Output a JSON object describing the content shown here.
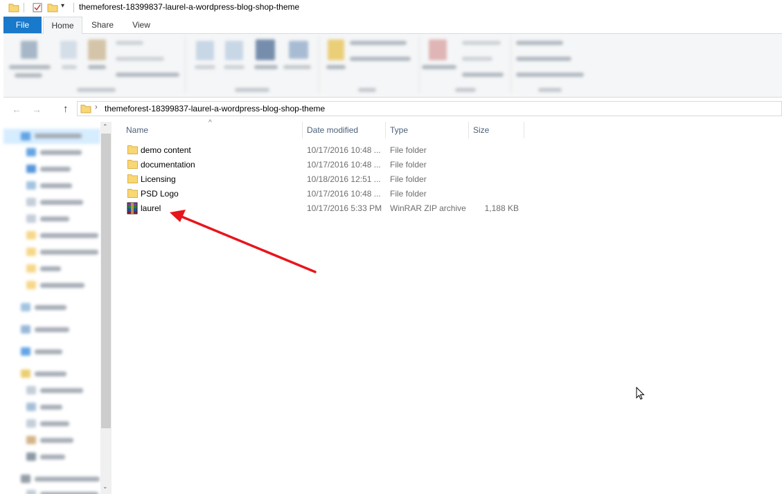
{
  "window": {
    "title": "themeforest-18399837-laurel-a-wordpress-blog-shop-theme",
    "qat_menu_glyph": "▾"
  },
  "ribbon": {
    "tabs": {
      "file": "File",
      "home": "Home",
      "share": "Share",
      "view": "View"
    },
    "active_tab": "Home",
    "accent_color": "#1979ca"
  },
  "address": {
    "path": "themeforest-18399837-laurel-a-wordpress-blog-shop-theme",
    "back_glyph": "←",
    "forward_glyph": "→",
    "up_glyph": "↑",
    "chevron_glyph": "›"
  },
  "columns": {
    "name": "Name",
    "date": "Date modified",
    "type": "Type",
    "size": "Size",
    "sort_glyph": "^"
  },
  "files": [
    {
      "name": "demo content",
      "date": "10/17/2016 10:48 ...",
      "type": "File folder",
      "size": "",
      "icon": "folder-icon"
    },
    {
      "name": "documentation",
      "date": "10/17/2016 10:48 ...",
      "type": "File folder",
      "size": "",
      "icon": "folder-icon"
    },
    {
      "name": "Licensing",
      "date": "10/18/2016 12:51 ...",
      "type": "File folder",
      "size": "",
      "icon": "folder-icon"
    },
    {
      "name": "PSD Logo",
      "date": "10/17/2016 10:48 ...",
      "type": "File folder",
      "size": "",
      "icon": "folder-icon"
    },
    {
      "name": "laurel",
      "date": "10/17/2016 5:33 PM",
      "type": "WinRAR ZIP archive",
      "size": "1,188 KB",
      "icon": "winrar-archive-icon"
    }
  ],
  "scrollbar": {
    "up_glyph": "⌃",
    "down_glyph": "⌄"
  },
  "annotation": {
    "color": "#e8151b",
    "target": "laurel"
  }
}
